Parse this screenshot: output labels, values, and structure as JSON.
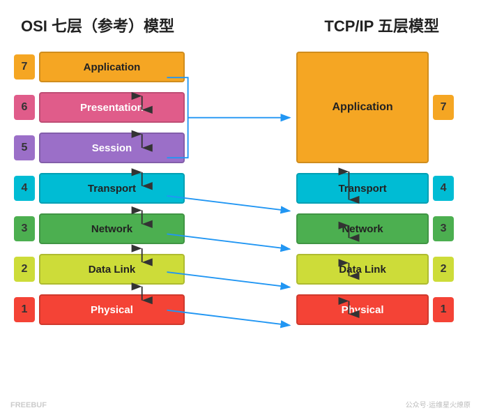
{
  "titles": {
    "left": "OSI 七层（参考）模型",
    "right": "TCP/IP 五层模型"
  },
  "osi": {
    "layers": [
      {
        "num": "7",
        "label": "Application",
        "numColor": "num-7",
        "boxColor": "box-7"
      },
      {
        "num": "6",
        "label": "Presentation",
        "numColor": "num-6",
        "boxColor": "box-6"
      },
      {
        "num": "5",
        "label": "Session",
        "numColor": "num-5",
        "boxColor": "box-5"
      },
      {
        "num": "4",
        "label": "Transport",
        "numColor": "num-4",
        "boxColor": "box-4"
      },
      {
        "num": "3",
        "label": "Network",
        "numColor": "num-3",
        "boxColor": "box-3"
      },
      {
        "num": "2",
        "label": "Data Link",
        "numColor": "num-2",
        "boxColor": "box-2"
      },
      {
        "num": "1",
        "label": "Physical",
        "numColor": "num-1",
        "boxColor": "box-1"
      }
    ]
  },
  "tcp": {
    "layers": [
      {
        "num": "7",
        "label": "Application",
        "numColor": "num-7",
        "type": "app-large"
      },
      {
        "num": "4",
        "label": "Transport",
        "numColor": "num-4",
        "type": "transport"
      },
      {
        "num": "3",
        "label": "Network",
        "numColor": "num-3",
        "type": "network"
      },
      {
        "num": "2",
        "label": "Data Link",
        "numColor": "num-2",
        "type": "datalink"
      },
      {
        "num": "1",
        "label": "Physical",
        "numColor": "num-1",
        "type": "physical"
      }
    ]
  },
  "watermark": "FREEBUF",
  "watermark2": "公众号·运维星火燎原"
}
